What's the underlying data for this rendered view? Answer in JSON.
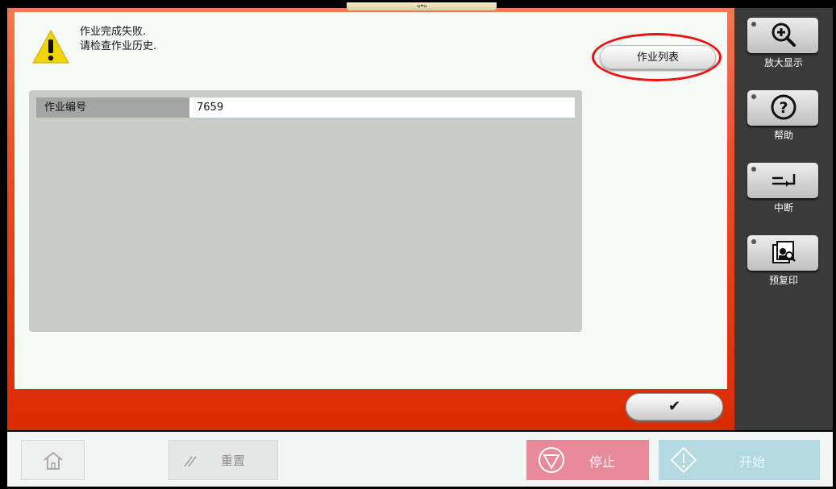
{
  "dialog": {
    "message_line1": "作业完成失败.",
    "message_line2": "请检查作业历史.",
    "job_list_button": "作业列表",
    "job_number_label": "作业编号",
    "job_number_value": "7659",
    "ok_symbol": "✔"
  },
  "sidebar": {
    "zoom_label": "放大显示",
    "help_label": "帮助",
    "interrupt_label": "中断",
    "preview_label": "预复印"
  },
  "bottom": {
    "reset_label": "重置",
    "stop_label": "停止",
    "start_label": "开始"
  },
  "handle": {
    "text": "‹‹•››"
  },
  "colors": {
    "frame_red": "#dc2a00",
    "warning_yellow": "#f2d500",
    "stop_pink": "#e88a9a",
    "start_blue": "#b2dae0",
    "highlight_red": "#ee1111"
  },
  "icons": {
    "warning": "warning-triangle-icon",
    "zoom": "zoom-in-icon",
    "help": "help-icon",
    "interrupt": "interrupt-icon",
    "preview": "preview-icon",
    "home": "home-icon",
    "reset": "reset-icon",
    "stop": "stop-icon",
    "start": "start-icon"
  }
}
